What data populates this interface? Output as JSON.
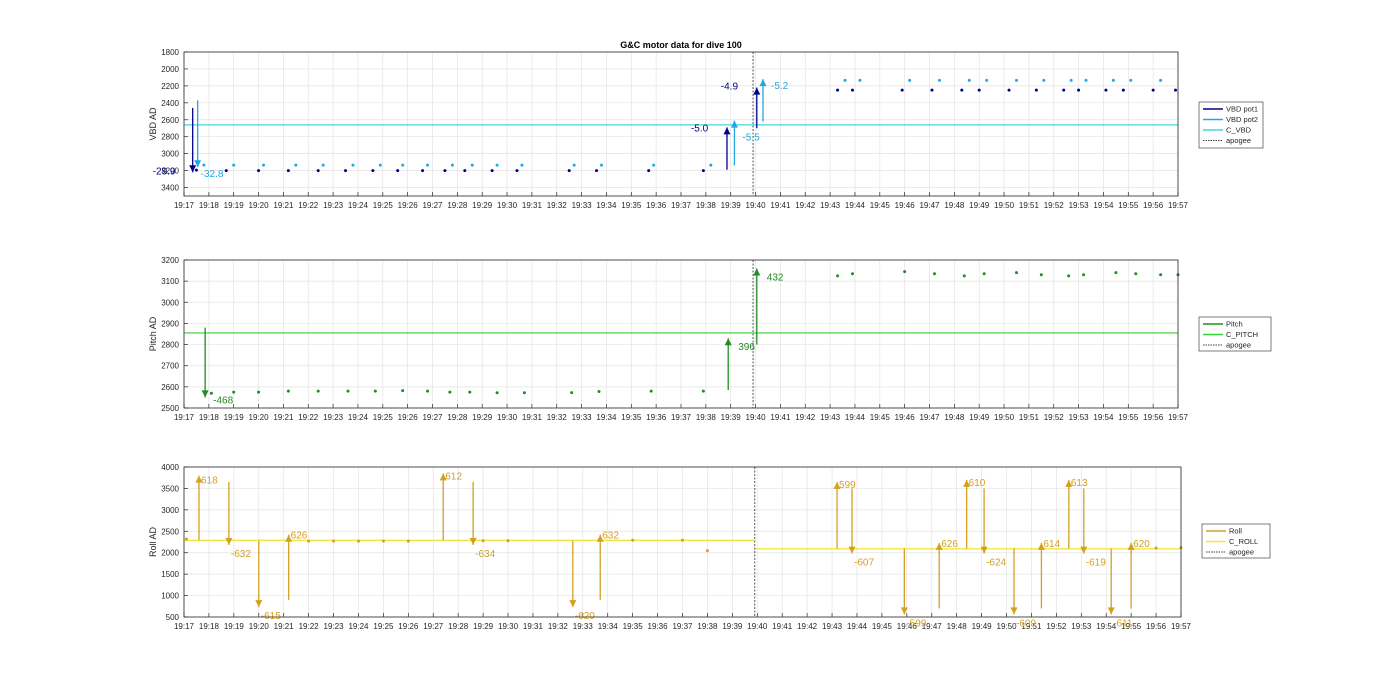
{
  "chart_data": [
    {
      "type": "scatter",
      "title": "G&C motor data for dive 100",
      "ylabel": "VBD AD",
      "ylim": [
        1800,
        3500
      ],
      "y_reversed": true,
      "yticks": [
        1800,
        2000,
        2200,
        2400,
        2600,
        2800,
        3000,
        3200,
        3400
      ],
      "grid": true,
      "legend_position": "outside-right",
      "colors": {
        "pot1": "#00008b",
        "pot2": "#22a8e0",
        "c_line": "#3fd9e0",
        "apogee": "#404040"
      },
      "legend": [
        {
          "name": "VBD pot1",
          "color": "#00008b",
          "style": "solid"
        },
        {
          "name": "VBD pot2",
          "color": "#22a8e0",
          "style": "solid"
        },
        {
          "name": "C_VBD",
          "color": "#3fd9e0",
          "style": "solid"
        },
        {
          "name": "apogee",
          "color": "#404040",
          "style": "dashed"
        }
      ],
      "c_line_value": 2660,
      "pot1_points": [
        [
          17.5,
          3195
        ],
        [
          18.7,
          3200
        ],
        [
          20.0,
          3200
        ],
        [
          21.2,
          3200
        ],
        [
          22.4,
          3200
        ],
        [
          23.5,
          3200
        ],
        [
          24.6,
          3200
        ],
        [
          25.6,
          3200
        ],
        [
          26.6,
          3200
        ],
        [
          27.5,
          3200
        ],
        [
          28.3,
          3200
        ],
        [
          29.4,
          3200
        ],
        [
          30.4,
          3200
        ],
        [
          32.5,
          3200
        ],
        [
          33.6,
          3200
        ],
        [
          35.7,
          3200
        ],
        [
          37.9,
          3200
        ],
        [
          43.3,
          2250
        ],
        [
          43.9,
          2250
        ],
        [
          45.9,
          2250
        ],
        [
          47.1,
          2250
        ],
        [
          48.3,
          2250
        ],
        [
          49.0,
          2250
        ],
        [
          50.2,
          2250
        ],
        [
          51.3,
          2250
        ],
        [
          52.4,
          2250
        ],
        [
          53.0,
          2250
        ],
        [
          54.1,
          2250
        ],
        [
          54.8,
          2250
        ],
        [
          56.0,
          2250
        ],
        [
          56.9,
          2250
        ]
      ],
      "pot2_points": [
        [
          17.8,
          3135
        ],
        [
          19.0,
          3135
        ],
        [
          20.2,
          3135
        ],
        [
          21.5,
          3135
        ],
        [
          22.6,
          3135
        ],
        [
          23.8,
          3135
        ],
        [
          24.9,
          3135
        ],
        [
          25.8,
          3135
        ],
        [
          26.8,
          3135
        ],
        [
          27.8,
          3135
        ],
        [
          28.6,
          3135
        ],
        [
          29.6,
          3135
        ],
        [
          30.6,
          3135
        ],
        [
          32.7,
          3135
        ],
        [
          33.8,
          3135
        ],
        [
          35.9,
          3135
        ],
        [
          38.2,
          3135
        ],
        [
          43.6,
          2135
        ],
        [
          44.2,
          2135
        ],
        [
          46.2,
          2135
        ],
        [
          47.4,
          2135
        ],
        [
          48.6,
          2135
        ],
        [
          49.3,
          2135
        ],
        [
          50.5,
          2135
        ],
        [
          51.6,
          2135
        ],
        [
          52.7,
          2135
        ],
        [
          53.3,
          2135
        ],
        [
          54.4,
          2135
        ],
        [
          55.1,
          2135
        ],
        [
          56.3,
          2135
        ]
      ],
      "arrows": [
        {
          "x": 17.35,
          "from": 2460,
          "to": 3220,
          "series": "pot1",
          "label": "-29.9",
          "label_dx": -40,
          "label_dy": 2
        },
        {
          "x": 17.55,
          "from": 2370,
          "to": 3160,
          "series": "pot2",
          "label": "-32.8",
          "label_dx": 3,
          "label_dy": 10
        },
        {
          "x": 38.85,
          "from": 3190,
          "to": 2690,
          "series": "pot1",
          "label": "-5.0",
          "label_dx": -36,
          "label_dy": 4
        },
        {
          "x": 39.15,
          "from": 3140,
          "to": 2610,
          "series": "pot2",
          "label": "-5.5",
          "label_dx": 8,
          "label_dy": 20
        },
        {
          "x": 40.05,
          "from": 2700,
          "to": 2220,
          "series": "pot1",
          "label": "-4.9",
          "label_dx": -36,
          "label_dy": 2
        },
        {
          "x": 40.3,
          "from": 2620,
          "to": 2120,
          "series": "pot2",
          "label": "-5.2",
          "label_dx": 8,
          "label_dy": 10
        }
      ],
      "apogee_x": 39.9
    },
    {
      "type": "scatter",
      "ylabel": "Pitch AD",
      "ylim": [
        2500,
        3200
      ],
      "yticks": [
        2500,
        2600,
        2700,
        2800,
        2900,
        3000,
        3100,
        3200
      ],
      "grid": true,
      "legend_position": "outside-right",
      "colors": {
        "main": "#228b22",
        "c_line": "#36d336",
        "apogee": "#404040"
      },
      "legend": [
        {
          "name": "Pitch",
          "color": "#228b22",
          "style": "solid"
        },
        {
          "name": "C_PITCH",
          "color": "#36d336",
          "style": "solid"
        },
        {
          "name": "apogee",
          "color": "#404040",
          "style": "dashed"
        }
      ],
      "c_line_value": 2855,
      "points": [
        [
          18.1,
          2570
        ],
        [
          19.0,
          2575
        ],
        [
          20.0,
          2575
        ],
        [
          21.2,
          2580
        ],
        [
          22.4,
          2580
        ],
        [
          23.6,
          2580
        ],
        [
          24.7,
          2580
        ],
        [
          25.8,
          2582
        ],
        [
          26.8,
          2580
        ],
        [
          27.7,
          2575
        ],
        [
          28.5,
          2575
        ],
        [
          29.6,
          2572
        ],
        [
          30.7,
          2572
        ],
        [
          32.6,
          2573
        ],
        [
          33.7,
          2578
        ],
        [
          35.8,
          2580
        ],
        [
          37.9,
          2580
        ],
        [
          43.3,
          3125
        ],
        [
          43.9,
          3135
        ],
        [
          46.0,
          3145
        ],
        [
          47.2,
          3135
        ],
        [
          48.4,
          3125
        ],
        [
          49.2,
          3135
        ],
        [
          50.5,
          3140
        ],
        [
          51.5,
          3130
        ],
        [
          52.6,
          3125
        ],
        [
          53.2,
          3130
        ],
        [
          54.5,
          3140
        ],
        [
          55.3,
          3135
        ],
        [
          56.3,
          3130
        ],
        [
          57.0,
          3130
        ]
      ],
      "arrows": [
        {
          "x": 17.85,
          "from": 2880,
          "to": 2550,
          "label": "-468",
          "label_dx": 8,
          "label_dy": 6
        },
        {
          "x": 38.9,
          "from": 2585,
          "to": 2830,
          "label": "396",
          "label_dx": 10,
          "label_dy": 12
        },
        {
          "x": 40.05,
          "from": 2800,
          "to": 3160,
          "label": "432",
          "label_dx": 10,
          "label_dy": 12
        }
      ],
      "apogee_x": 39.9
    },
    {
      "type": "scatter",
      "ylabel": "Roll AD",
      "ylim": [
        500,
        4000
      ],
      "yticks": [
        500,
        1000,
        1500,
        2000,
        2500,
        3000,
        3500,
        4000
      ],
      "grid": true,
      "legend_position": "outside-right",
      "colors": {
        "main": "#d4a020",
        "c_line": "#f2e640",
        "apogee": "#404040"
      },
      "legend": [
        {
          "name": "Roll",
          "color": "#d4a020",
          "style": "solid"
        },
        {
          "name": "C_ROLL",
          "color": "#f2e640",
          "style": "solid"
        },
        {
          "name": "apogee",
          "color": "#404040",
          "style": "dashed"
        }
      ],
      "c_line_segments": [
        [
          17.0,
          39.9,
          2290
        ],
        [
          39.9,
          57.0,
          2090
        ]
      ],
      "points": [
        [
          17.1,
          2320
        ],
        [
          22.0,
          2270
        ],
        [
          23.0,
          2270
        ],
        [
          24.0,
          2270
        ],
        [
          25.0,
          2270
        ],
        [
          26.0,
          2270
        ],
        [
          29.0,
          2280
        ],
        [
          30.0,
          2280
        ],
        [
          35.0,
          2290
        ],
        [
          37.0,
          2290
        ],
        [
          38.0,
          2050
        ],
        [
          56.0,
          2110
        ],
        [
          57.0,
          2120
        ]
      ],
      "arrows": [
        {
          "x": 17.6,
          "from": 2300,
          "to": 3800,
          "label": "618",
          "label_dx": 2,
          "label_dy": 8
        },
        {
          "x": 18.8,
          "from": 3650,
          "to": 2180,
          "label": "-632",
          "label_dx": 2,
          "label_dy": 12
        },
        {
          "x": 20.0,
          "from": 2280,
          "to": 730,
          "label": "-615",
          "label_dx": 2,
          "label_dy": 12
        },
        {
          "x": 21.2,
          "from": 900,
          "to": 2420,
          "label": "626",
          "label_dx": 2,
          "label_dy": 4
        },
        {
          "x": 27.4,
          "from": 2300,
          "to": 3850,
          "label": "612",
          "label_dx": 2,
          "label_dy": 6
        },
        {
          "x": 28.6,
          "from": 3650,
          "to": 2180,
          "label": "-634",
          "label_dx": 2,
          "label_dy": 12
        },
        {
          "x": 32.6,
          "from": 2280,
          "to": 730,
          "label": "-620",
          "label_dx": 2,
          "label_dy": 12
        },
        {
          "x": 33.7,
          "from": 900,
          "to": 2420,
          "label": "632",
          "label_dx": 2,
          "label_dy": 4
        },
        {
          "x": 43.2,
          "from": 2100,
          "to": 3650,
          "label": "599",
          "label_dx": 2,
          "label_dy": 6
        },
        {
          "x": 43.8,
          "from": 3500,
          "to": 1980,
          "label": "-607",
          "label_dx": 2,
          "label_dy": 12
        },
        {
          "x": 45.9,
          "from": 2100,
          "to": 560,
          "label": "-599",
          "label_dx": 2,
          "label_dy": 12
        },
        {
          "x": 47.3,
          "from": 700,
          "to": 2230,
          "label": "626",
          "label_dx": 2,
          "label_dy": 4
        },
        {
          "x": 48.4,
          "from": 2100,
          "to": 3700,
          "label": "610",
          "label_dx": 2,
          "label_dy": 6
        },
        {
          "x": 49.1,
          "from": 3500,
          "to": 1980,
          "label": "-624",
          "label_dx": 2,
          "label_dy": 12
        },
        {
          "x": 50.3,
          "from": 2100,
          "to": 560,
          "label": "-609",
          "label_dx": 2,
          "label_dy": 12
        },
        {
          "x": 51.4,
          "from": 700,
          "to": 2230,
          "label": "614",
          "label_dx": 2,
          "label_dy": 4
        },
        {
          "x": 52.5,
          "from": 2100,
          "to": 3700,
          "label": "613",
          "label_dx": 2,
          "label_dy": 6
        },
        {
          "x": 53.1,
          "from": 3500,
          "to": 1980,
          "label": "-619",
          "label_dx": 2,
          "label_dy": 12
        },
        {
          "x": 54.2,
          "from": 2100,
          "to": 560,
          "label": "-611",
          "label_dx": 2,
          "label_dy": 12
        },
        {
          "x": 55.0,
          "from": 700,
          "to": 2230,
          "label": "620",
          "label_dx": 2,
          "label_dy": 4
        }
      ],
      "apogee_x": 39.9
    }
  ],
  "x_axis": {
    "xlim": [
      17,
      57
    ],
    "tick_labels": [
      "19:17",
      "19:18",
      "19:19",
      "19:20",
      "19:21",
      "19:22",
      "19:23",
      "19:24",
      "19:25",
      "19:26",
      "19:27",
      "19:28",
      "19:29",
      "19:30",
      "19:31",
      "19:32",
      "19:33",
      "19:34",
      "19:35",
      "19:36",
      "19:37",
      "19:38",
      "19:39",
      "19:40",
      "19:41",
      "19:42",
      "19:43",
      "19:44",
      "19:45",
      "19:46",
      "19:47",
      "19:48",
      "19:49",
      "19:50",
      "19:51",
      "19:52",
      "19:53",
      "19:54",
      "19:55",
      "19:56",
      "19:57"
    ]
  }
}
